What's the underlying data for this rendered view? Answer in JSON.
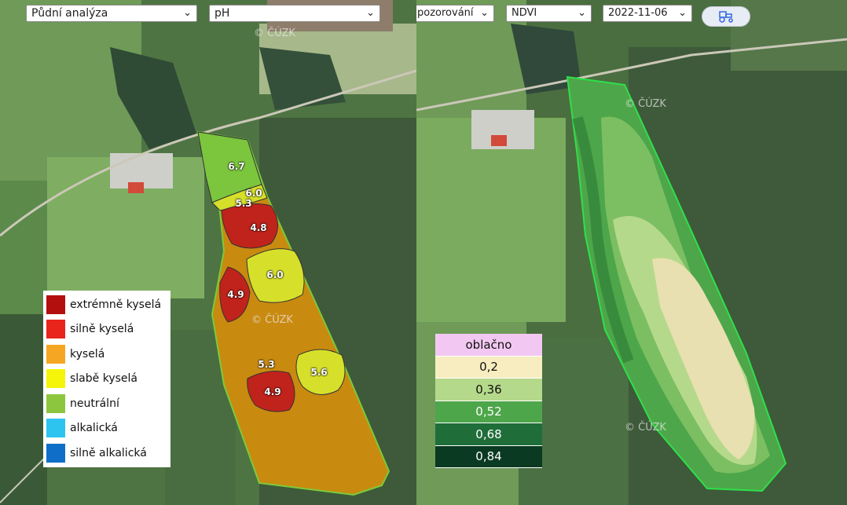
{
  "left_panel": {
    "analysis_select": "Půdní analýza",
    "parameter_select": "pH",
    "watermark": "© ČÚZK",
    "zone_labels": [
      "6.7",
      "6.0",
      "5.3",
      "4.8",
      "6.0",
      "4.9",
      "5.3",
      "5.6",
      "4.9"
    ],
    "legend": [
      {
        "label": "extrémně kyselá",
        "color": "#b30f0f"
      },
      {
        "label": "silně kyselá",
        "color": "#e8241b"
      },
      {
        "label": "kyselá",
        "color": "#f5a623"
      },
      {
        "label": "slabě kyselá",
        "color": "#f5f50a"
      },
      {
        "label": "neutrální",
        "color": "#8cc63e"
      },
      {
        "label": "alkalická",
        "color": "#2ec4f0"
      },
      {
        "label": "silně alkalická",
        "color": "#0f6fc8"
      }
    ],
    "zone_colors": {
      "kysela": "#c98a10",
      "silne_kysela": "#c0231b",
      "slabe_kysela": "#d6e02a",
      "neutralni": "#7cc63e"
    }
  },
  "right_panel": {
    "observation_select": "pozorování",
    "index_select": "NDVI",
    "date_select": "2022-11-06",
    "tractor_icon": "tractor-icon",
    "watermark": "© ČÚZK",
    "legend": [
      {
        "label": "oblačno",
        "color": "#f2c8f2",
        "text_color": "#111"
      },
      {
        "label": "0,2",
        "color": "#f7edc0",
        "text_color": "#111"
      },
      {
        "label": "0,36",
        "color": "#b5d98a",
        "text_color": "#111"
      },
      {
        "label": "0,52",
        "color": "#4ea64a",
        "text_color": "#fff"
      },
      {
        "label": "0,68",
        "color": "#1f6e3a",
        "text_color": "#fff"
      },
      {
        "label": "0,84",
        "color": "#0b3a22",
        "text_color": "#fff"
      }
    ]
  }
}
